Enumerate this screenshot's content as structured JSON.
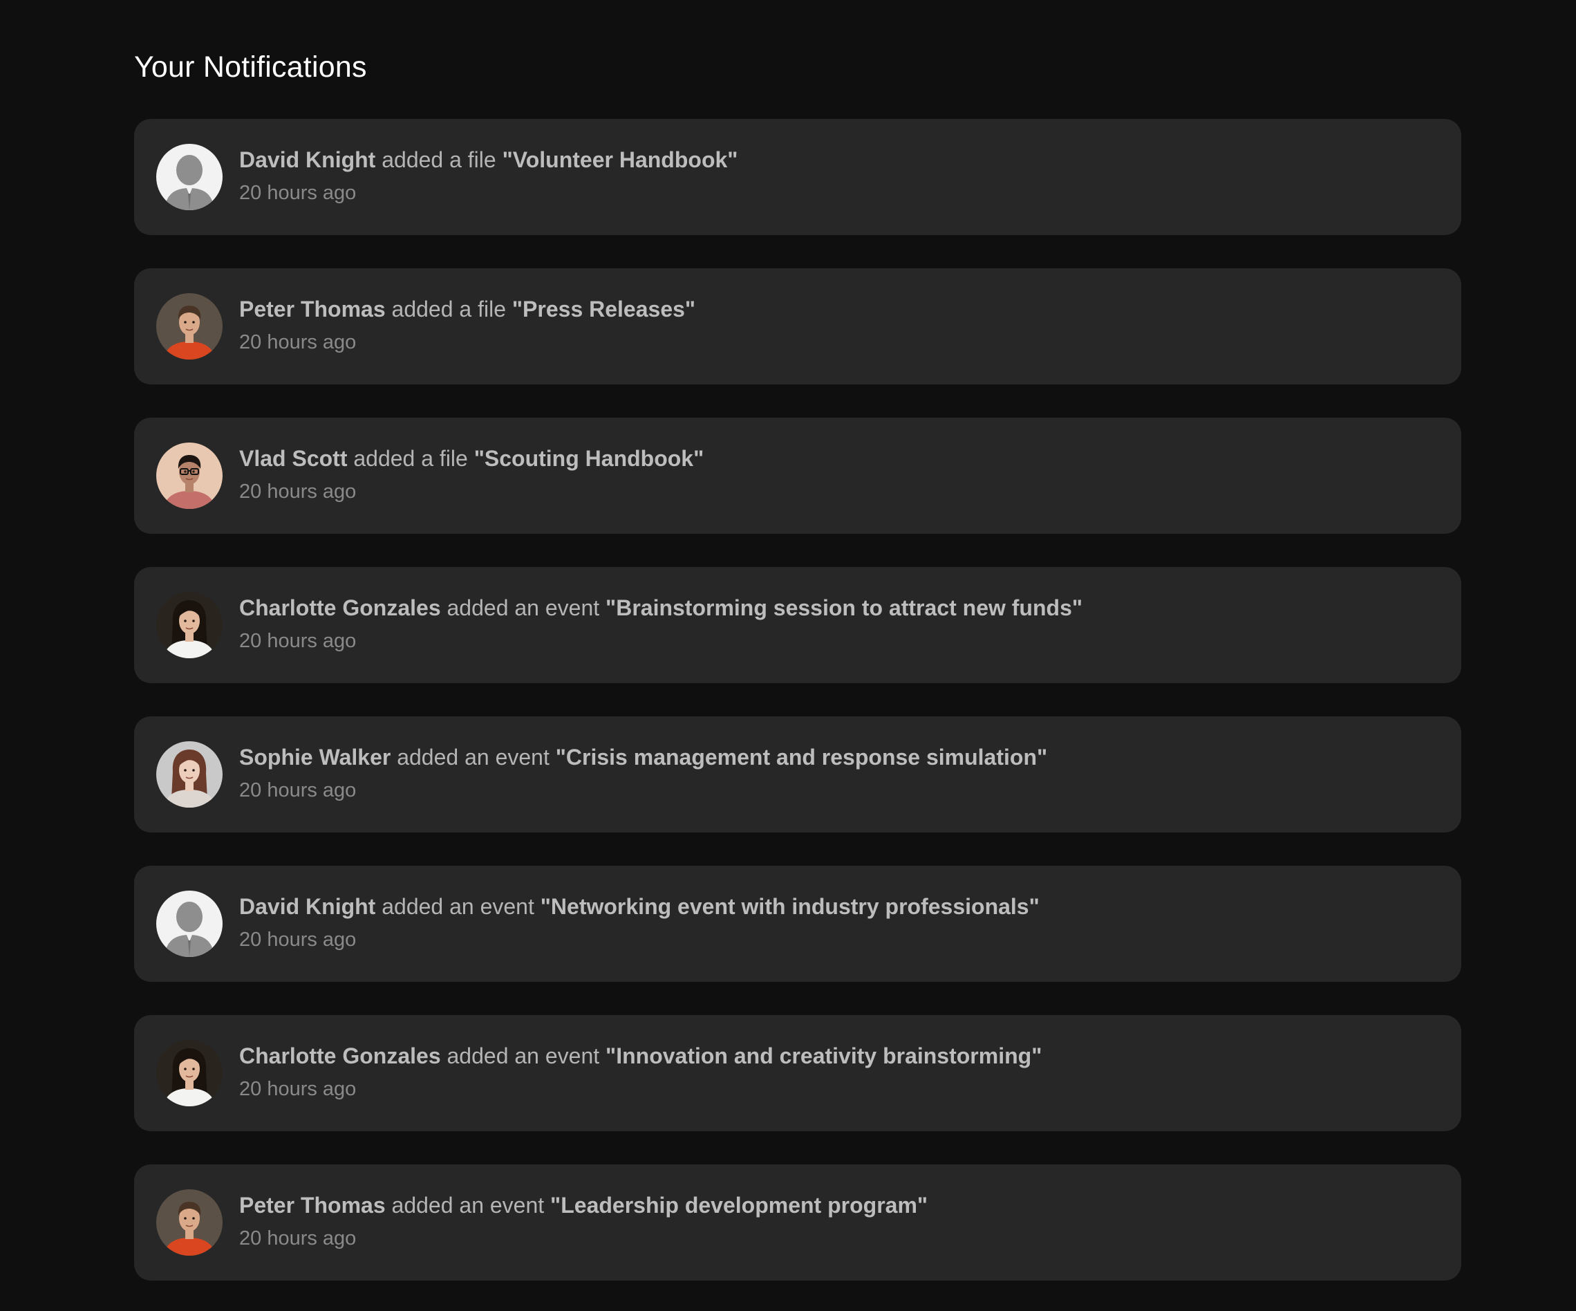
{
  "header": {
    "title": "Your Notifications"
  },
  "notifications": [
    {
      "name": "David Knight",
      "action": "added a file",
      "subject": "\"Volunteer Handbook\"",
      "time": "20 hours ago",
      "avatar": "default-avatar-icon",
      "avatar_colors": {
        "bg": "#f2f2f2",
        "fg": "#8e8e8e"
      }
    },
    {
      "name": "Peter Thomas",
      "action": "added a file",
      "subject": "\"Press Releases\"",
      "time": "20 hours ago",
      "avatar": "peter-thomas-avatar",
      "avatar_colors": {
        "bg": "#5b5147",
        "skin": "#d9a98a",
        "hair": "#4a3426",
        "shirt": "#d9461f"
      }
    },
    {
      "name": "Vlad Scott",
      "action": "added a file",
      "subject": "\"Scouting Handbook\"",
      "time": "20 hours ago",
      "avatar": "vlad-scott-avatar",
      "avatar_colors": {
        "bg": "#e8c8b0",
        "skin": "#b7826a",
        "hair": "#1d1512",
        "shirt": "#c56f6a"
      }
    },
    {
      "name": "Charlotte Gonzales",
      "action": "added an event",
      "subject": "\"Brainstorming session to attract new funds\"",
      "time": "20 hours ago",
      "avatar": "charlotte-gonzales-avatar",
      "avatar_colors": {
        "bg": "#2a241e",
        "skin": "#e2b99c",
        "hair": "#1a120d",
        "shirt": "#f3f3f1"
      }
    },
    {
      "name": "Sophie Walker",
      "action": "added an event",
      "subject": "\"Crisis management and response simulation\"",
      "time": "20 hours ago",
      "avatar": "sophie-walker-avatar",
      "avatar_colors": {
        "bg": "#c9c9c9",
        "skin": "#edcdbb",
        "hair": "#6a3a2a",
        "shirt": "#ddd6d0"
      }
    },
    {
      "name": "David Knight",
      "action": "added an event",
      "subject": "\"Networking event with industry professionals\"",
      "time": "20 hours ago",
      "avatar": "default-avatar-icon",
      "avatar_colors": {
        "bg": "#f2f2f2",
        "fg": "#8e8e8e"
      }
    },
    {
      "name": "Charlotte Gonzales",
      "action": "added an event",
      "subject": "\"Innovation and creativity brainstorming\"",
      "time": "20 hours ago",
      "avatar": "charlotte-gonzales-avatar",
      "avatar_colors": {
        "bg": "#2a241e",
        "skin": "#e2b99c",
        "hair": "#1a120d",
        "shirt": "#f3f3f1"
      }
    },
    {
      "name": "Peter Thomas",
      "action": "added an event",
      "subject": "\"Leadership development program\"",
      "time": "20 hours ago",
      "avatar": "peter-thomas-avatar",
      "avatar_colors": {
        "bg": "#5b5147",
        "skin": "#d9a98a",
        "hair": "#4a3426",
        "shirt": "#d9461f"
      }
    }
  ],
  "colors": {
    "page_bg": "#0f0f0f",
    "card_bg": "#272727",
    "title": "#ffffff",
    "primary_text": "#bdbdbd",
    "secondary_text": "#8a8a8a"
  }
}
